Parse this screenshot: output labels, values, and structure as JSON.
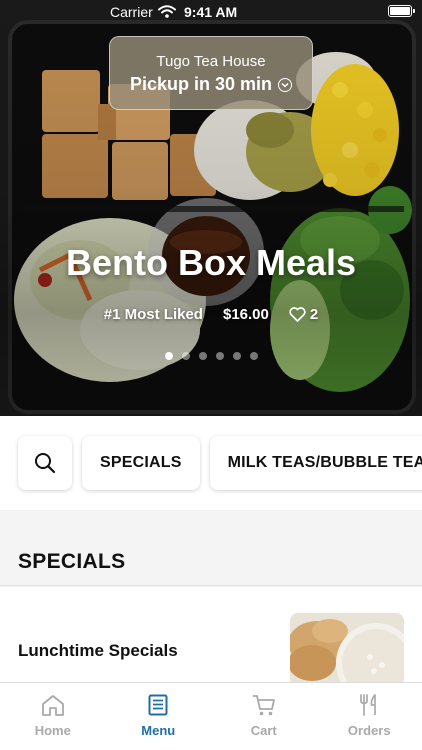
{
  "status_bar": {
    "carrier": "Carrier",
    "time": "9:41 AM"
  },
  "store": {
    "name": "Tugo Tea House",
    "pickup": "Pickup in 30 min"
  },
  "hero": {
    "title": "Bento Box Meals",
    "badge": "#1 Most Liked",
    "price": "$16.00",
    "likes": "2",
    "slide_count": 6,
    "active_slide": 1
  },
  "categories": [
    "SPECIALS",
    "MILK TEAS/BUBBLE TEAS"
  ],
  "section": {
    "title": "SPECIALS"
  },
  "items": [
    {
      "name": "Lunchtime Specials"
    }
  ],
  "tabs": [
    {
      "label": "Home",
      "icon": "home-icon",
      "active": false
    },
    {
      "label": "Menu",
      "icon": "menu-icon",
      "active": true
    },
    {
      "label": "Cart",
      "icon": "cart-icon",
      "active": false
    },
    {
      "label": "Orders",
      "icon": "orders-icon",
      "active": false
    }
  ],
  "colors": {
    "accent": "#1e6fa8",
    "inactive_tab": "#a9a9a9"
  }
}
